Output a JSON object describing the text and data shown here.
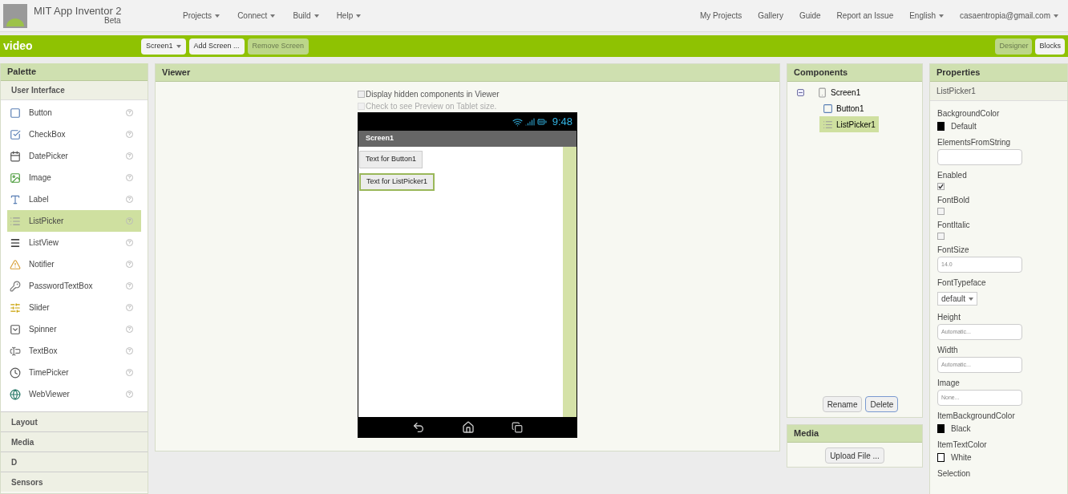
{
  "app": {
    "title": "MIT App Inventor 2",
    "subtitle": "Beta"
  },
  "top_menu": [
    {
      "label": "Projects",
      "dropdown": true
    },
    {
      "label": "Connect",
      "dropdown": true
    },
    {
      "label": "Build",
      "dropdown": true
    },
    {
      "label": "Help",
      "dropdown": true
    }
  ],
  "top_links": [
    {
      "label": "My Projects",
      "dropdown": false
    },
    {
      "label": "Gallery",
      "dropdown": false
    },
    {
      "label": "Guide",
      "dropdown": false
    },
    {
      "label": "Report an Issue",
      "dropdown": false
    },
    {
      "label": "English",
      "dropdown": true
    },
    {
      "label": "casaentropia@gmail.com",
      "dropdown": true
    }
  ],
  "toolbar": {
    "project": "video",
    "buttons": [
      {
        "label": "Screen1",
        "dropdown": true,
        "disabled": false
      },
      {
        "label": "Add Screen ...",
        "dropdown": false,
        "disabled": false
      },
      {
        "label": "Remove Screen",
        "dropdown": false,
        "disabled": true
      }
    ],
    "views": [
      {
        "label": "Designer",
        "selected": true
      },
      {
        "label": "Blocks",
        "selected": false
      }
    ]
  },
  "palette": {
    "title": "Palette",
    "open_category": "User Interface",
    "items": [
      {
        "label": "Button",
        "help": "?",
        "selected": false
      },
      {
        "label": "CheckBox",
        "help": "?",
        "selected": false
      },
      {
        "label": "DatePicker",
        "help": "?",
        "selected": false
      },
      {
        "label": "Image",
        "help": "?",
        "selected": false
      },
      {
        "label": "Label",
        "help": "?",
        "selected": false
      },
      {
        "label": "ListPicker",
        "help": "?",
        "selected": true
      },
      {
        "label": "ListView",
        "help": "?",
        "selected": false
      },
      {
        "label": "Notifier",
        "help": "?",
        "selected": false
      },
      {
        "label": "PasswordTextBox",
        "help": "?",
        "selected": false
      },
      {
        "label": "Slider",
        "help": "?",
        "selected": false
      },
      {
        "label": "Spinner",
        "help": "?",
        "selected": false
      },
      {
        "label": "TextBox",
        "help": "?",
        "selected": false
      },
      {
        "label": "TimePicker",
        "help": "?",
        "selected": false
      },
      {
        "label": "WebViewer",
        "help": "?",
        "selected": false
      }
    ],
    "categories": [
      "Layout",
      "Media",
      "D",
      "Sensors"
    ]
  },
  "viewer": {
    "title": "Viewer",
    "options": [
      {
        "label": "Display hidden components in Viewer",
        "checked": false,
        "disabled": false
      },
      {
        "label": "Check to see Preview on Tablet size.",
        "checked": false,
        "disabled": true
      }
    ],
    "phone": {
      "time": "9:48",
      "screen_title": "Screen1",
      "widgets": [
        {
          "label": "Text for Button1",
          "selected": false
        },
        {
          "label": "Text for ListPicker1",
          "selected": true
        }
      ]
    }
  },
  "components": {
    "title": "Components",
    "tree": [
      {
        "label": "Screen1",
        "kind": "screen",
        "expanded": true,
        "selected": false,
        "children": [
          {
            "label": "Button1",
            "kind": "button",
            "selected": false
          },
          {
            "label": "ListPicker1",
            "kind": "listpicker",
            "selected": true
          }
        ]
      }
    ],
    "buttons": [
      {
        "label": "Rename",
        "focused": false
      },
      {
        "label": "Delete",
        "focused": true
      }
    ]
  },
  "media": {
    "title": "Media",
    "button": "Upload File ..."
  },
  "properties": {
    "title": "Properties",
    "component": "ListPicker1",
    "items": [
      {
        "kind": "color",
        "label": "BackgroundColor",
        "value": "Default",
        "color": "#000000"
      },
      {
        "kind": "text",
        "label": "ElementsFromString",
        "value": ""
      },
      {
        "kind": "checkbox",
        "label": "Enabled",
        "checked": true
      },
      {
        "kind": "checkbox",
        "label": "FontBold",
        "checked": false
      },
      {
        "kind": "checkbox",
        "label": "FontItalic",
        "checked": false
      },
      {
        "kind": "text",
        "label": "FontSize",
        "value": "14.0"
      },
      {
        "kind": "select",
        "label": "FontTypeface",
        "value": "default"
      },
      {
        "kind": "text",
        "label": "Height",
        "value": "Automatic..."
      },
      {
        "kind": "text",
        "label": "Width",
        "value": "Automatic..."
      },
      {
        "kind": "text",
        "label": "Image",
        "value": "None..."
      },
      {
        "kind": "color",
        "label": "ItemBackgroundColor",
        "value": "Black",
        "color": "#000000"
      },
      {
        "kind": "color",
        "label": "ItemTextColor",
        "value": "White",
        "color": "#ffffff"
      },
      {
        "kind": "heading",
        "label": "Selection"
      }
    ]
  }
}
